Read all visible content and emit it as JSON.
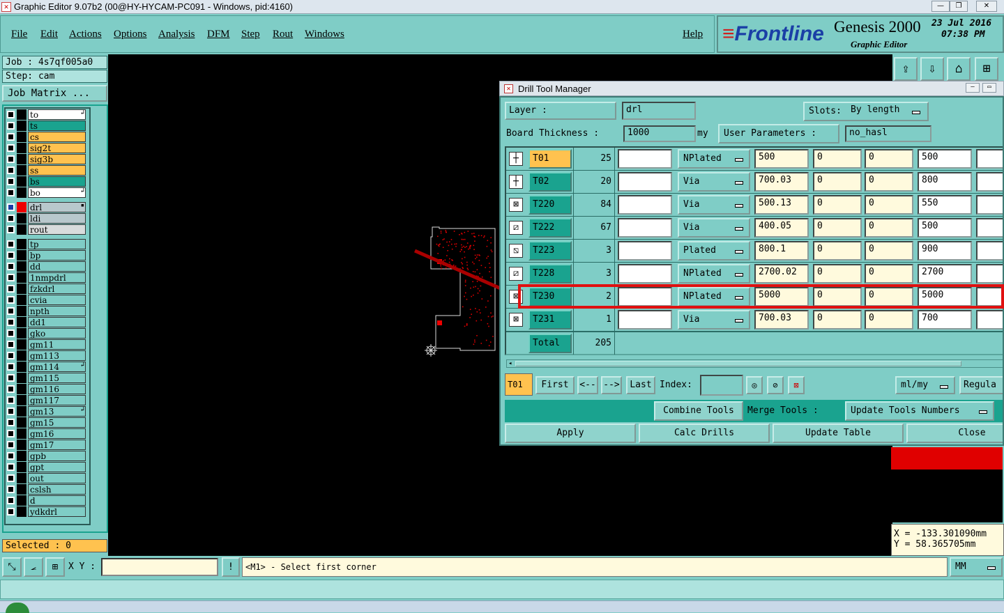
{
  "window": {
    "title": "Graphic Editor 9.07b2 (00@HY-HYCAM-PC091 - Windows, pid:4160)"
  },
  "menu": [
    "File",
    "Edit",
    "Actions",
    "Options",
    "Analysis",
    "DFM",
    "Step",
    "Rout",
    "Windows"
  ],
  "help": "Help",
  "brand": {
    "name": "Frontline",
    "product": "Genesis 2000",
    "subtitle": "Graphic Editor",
    "date": "23 Jul 2016",
    "time": "07:38 PM"
  },
  "job": {
    "job_label": "Job : 4s7qf005a0",
    "step_label": "Step: cam",
    "matrix_button": "Job Matrix ..."
  },
  "layers": [
    {
      "name": "to",
      "color": "#ffffff",
      "mark": "↲"
    },
    {
      "name": "ts",
      "color": "#1aa38f",
      "mark": ""
    },
    {
      "name": "cs",
      "color": "#ffc24f",
      "mark": ""
    },
    {
      "name": "sig2t",
      "color": "#ffc24f",
      "mark": ""
    },
    {
      "name": "sig3b",
      "color": "#ffc24f",
      "mark": ""
    },
    {
      "name": "ss",
      "color": "#ffc24f",
      "mark": ""
    },
    {
      "name": "bs",
      "color": "#1aa38f",
      "mark": ""
    },
    {
      "name": "bo",
      "color": "#ffffff",
      "mark": "↲"
    },
    {
      "name": "drl",
      "color": "#b8c8cc",
      "mark": "▪"
    },
    {
      "name": "ldi",
      "color": "#b8c8cc",
      "mark": ""
    },
    {
      "name": "rout",
      "color": "#d8dcdc",
      "mark": ""
    },
    {
      "name": "tp",
      "color": "#7fcdc6",
      "mark": ""
    },
    {
      "name": "bp",
      "color": "#7fcdc6",
      "mark": ""
    },
    {
      "name": "dd",
      "color": "#7fcdc6",
      "mark": ""
    },
    {
      "name": "1nmpdrl",
      "color": "#7fcdc6",
      "mark": ""
    },
    {
      "name": "fzkdrl",
      "color": "#7fcdc6",
      "mark": ""
    },
    {
      "name": "cvia",
      "color": "#7fcdc6",
      "mark": ""
    },
    {
      "name": "npth",
      "color": "#7fcdc6",
      "mark": ""
    },
    {
      "name": "dd1",
      "color": "#7fcdc6",
      "mark": ""
    },
    {
      "name": "gko",
      "color": "#7fcdc6",
      "mark": ""
    },
    {
      "name": "gm11",
      "color": "#7fcdc6",
      "mark": ""
    },
    {
      "name": "gm113",
      "color": "#7fcdc6",
      "mark": ""
    },
    {
      "name": "gm114",
      "color": "#7fcdc6",
      "mark": "↲"
    },
    {
      "name": "gm115",
      "color": "#7fcdc6",
      "mark": ""
    },
    {
      "name": "gm116",
      "color": "#7fcdc6",
      "mark": ""
    },
    {
      "name": "gm117",
      "color": "#7fcdc6",
      "mark": ""
    },
    {
      "name": "gm13",
      "color": "#7fcdc6",
      "mark": "↲"
    },
    {
      "name": "gm15",
      "color": "#7fcdc6",
      "mark": ""
    },
    {
      "name": "gm16",
      "color": "#7fcdc6",
      "mark": ""
    },
    {
      "name": "gm17",
      "color": "#7fcdc6",
      "mark": ""
    },
    {
      "name": "gpb",
      "color": "#7fcdc6",
      "mark": ""
    },
    {
      "name": "gpt",
      "color": "#7fcdc6",
      "mark": ""
    },
    {
      "name": "out",
      "color": "#7fcdc6",
      "mark": ""
    },
    {
      "name": "cslsh",
      "color": "#7fcdc6",
      "mark": ""
    },
    {
      "name": "d",
      "color": "#7fcdc6",
      "mark": ""
    },
    {
      "name": "ydkdrl",
      "color": "#7fcdc6",
      "mark": ""
    }
  ],
  "selected": "Selected : 0",
  "status": {
    "xy_label": "X Y :",
    "xy_value": "",
    "prompt": "<M1> - Select first corner",
    "units": "MM"
  },
  "coords": {
    "x": "X = -133.301090mm",
    "y": "Y = 58.365705mm"
  },
  "dtm": {
    "title": "Drill Tool Manager",
    "layer_label": "Layer :",
    "layer_value": "drl",
    "slots_label": "Slots:",
    "slots_value": "By length",
    "board_label": "Board Thickness :",
    "board_value": "1000",
    "board_unit": "my",
    "user_params_label": "User Parameters :",
    "user_params_value": "no_hasl",
    "tools": [
      {
        "name": "T01",
        "count": "25",
        "type": "NPlated",
        "size": "500",
        "a": "0",
        "b": "0",
        "finish": "500"
      },
      {
        "name": "T02",
        "count": "20",
        "type": "Via",
        "size": "700.03",
        "a": "0",
        "b": "0",
        "finish": "800"
      },
      {
        "name": "T220",
        "count": "84",
        "type": "Via",
        "size": "500.13",
        "a": "0",
        "b": "0",
        "finish": "550"
      },
      {
        "name": "T222",
        "count": "67",
        "type": "Via",
        "size": "400.05",
        "a": "0",
        "b": "0",
        "finish": "500"
      },
      {
        "name": "T223",
        "count": "3",
        "type": "Plated",
        "size": "800.1",
        "a": "0",
        "b": "0",
        "finish": "900"
      },
      {
        "name": "T228",
        "count": "3",
        "type": "NPlated",
        "size": "2700.02",
        "a": "0",
        "b": "0",
        "finish": "2700"
      },
      {
        "name": "T230",
        "count": "2",
        "type": "NPlated",
        "size": "5000",
        "a": "0",
        "b": "0",
        "finish": "5000"
      },
      {
        "name": "T231",
        "count": "1",
        "type": "Via",
        "size": "700.03",
        "a": "0",
        "b": "0",
        "finish": "700"
      }
    ],
    "total_label": "Total",
    "total_value": "205",
    "current_tool": "T01",
    "nav": {
      "first": "First",
      "prev": "<--",
      "next": "-->",
      "last": "Last",
      "index": "Index:",
      "index_value": ""
    },
    "unit_select": "ml/my",
    "regular": "Regula",
    "combine": "Combine Tools",
    "merge": "Merge Tools :",
    "update_numbers": "Update Tools Numbers",
    "apply": "Apply",
    "calc": "Calc Drills",
    "update_table": "Update Table",
    "close": "Close"
  }
}
